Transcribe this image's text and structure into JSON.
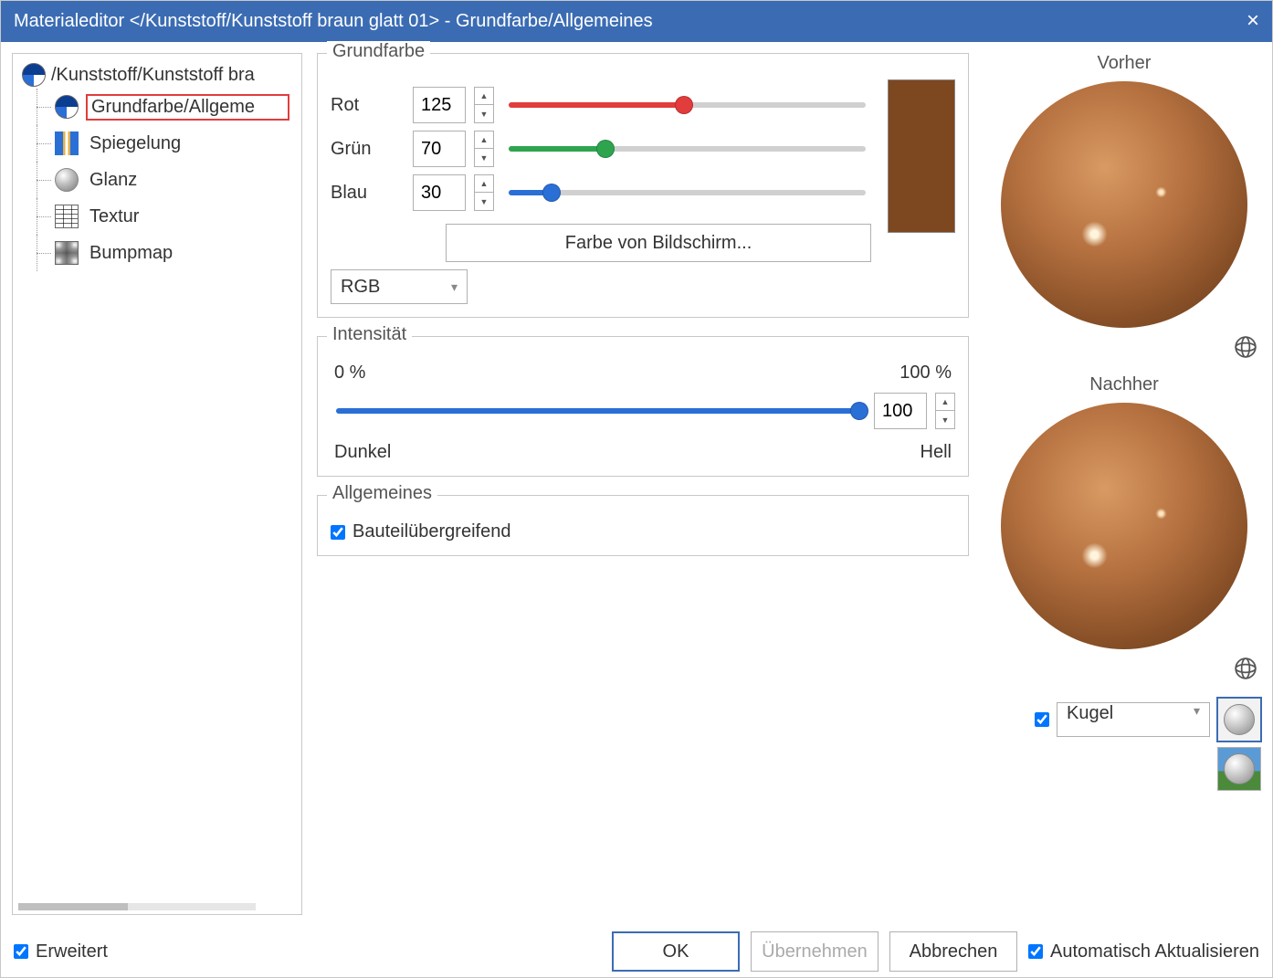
{
  "title": "Materialeditor   </Kunststoff/Kunststoff braun glatt 01>  - Grundfarbe/Allgemeines",
  "tree": {
    "root": "/Kunststoff/Kunststoff bra",
    "items": [
      "Grundfarbe/Allgeme",
      "Spiegelung",
      "Glanz",
      "Textur",
      "Bumpmap"
    ]
  },
  "grundfarbe": {
    "legend": "Grundfarbe",
    "rot": {
      "label": "Rot",
      "value": "125",
      "percent": 49
    },
    "gruen": {
      "label": "Grün",
      "value": "70",
      "percent": 27
    },
    "blau": {
      "label": "Blau",
      "value": "30",
      "percent": 12
    },
    "screen_btn": "Farbe von Bildschirm...",
    "mode": "RGB",
    "swatch_hex": "#7d4720"
  },
  "intensitaet": {
    "legend": "Intensität",
    "min_label": "0 %",
    "max_label": "100 %",
    "value": "100",
    "percent": 100,
    "dark": "Dunkel",
    "light": "Hell"
  },
  "allgemeines": {
    "legend": "Allgemeines",
    "bauteil": "Bauteilübergreifend"
  },
  "preview": {
    "before": "Vorher",
    "after": "Nachher",
    "shape": "Kugel"
  },
  "footer": {
    "erweitert": "Erweitert",
    "ok": "OK",
    "apply": "Übernehmen",
    "cancel": "Abbrechen",
    "auto": "Automatisch Aktualisieren"
  }
}
